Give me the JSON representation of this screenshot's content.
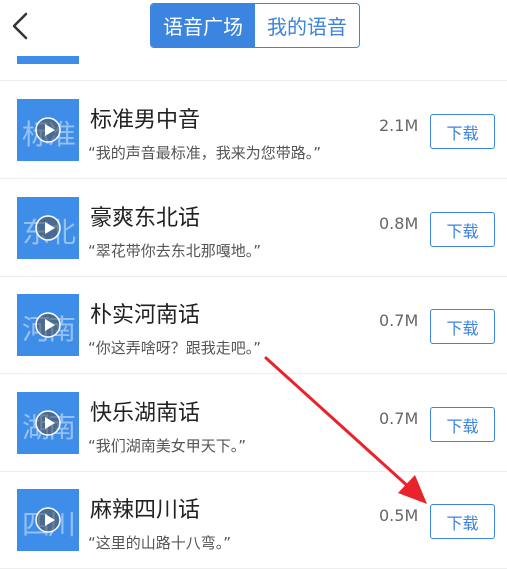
{
  "header": {
    "back_icon": "chevron-left-icon",
    "tabs": [
      {
        "label": "语音广场",
        "active": true
      },
      {
        "label": "我的语音",
        "active": false
      }
    ]
  },
  "voices": [
    {
      "name": "标准男中音",
      "quote": "“我的声音最标准，我来为您带路。”",
      "size": "2.1M",
      "thumb_text": "标准",
      "button": "下载"
    },
    {
      "name": "豪爽东北话",
      "quote": "“翠花带你去东北那嘎地。”",
      "size": "0.8M",
      "thumb_text": "东北",
      "button": "下载"
    },
    {
      "name": "朴实河南话",
      "quote": "“你这弄啥呀？跟我走吧。”",
      "size": "0.7M",
      "thumb_text": "河南",
      "button": "下载"
    },
    {
      "name": "快乐湖南话",
      "quote": "“我们湖南美女甲天下。”",
      "size": "0.7M",
      "thumb_text": "湖南",
      "button": "下载"
    },
    {
      "name": "麻辣四川话",
      "quote": "“这里的山路十八弯。”",
      "size": "0.5M",
      "thumb_text": "四川",
      "button": "下载"
    }
  ],
  "colors": {
    "accent": "#3b84e0",
    "thumb": "#3e8de8",
    "annotation_arrow": "#e8232b"
  }
}
